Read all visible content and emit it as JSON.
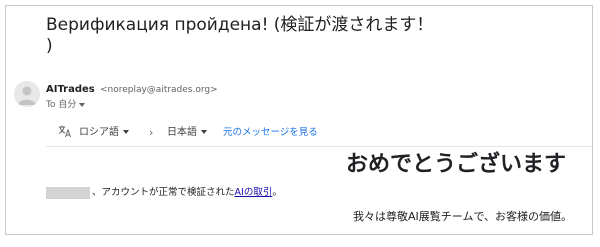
{
  "subject": "Верификация пройдена! (検証が渡されます！\n)",
  "sender": {
    "name": "AITrades",
    "email": "<noreplay@aitrades.org>",
    "to_label": "To 自分"
  },
  "translate_bar": {
    "icon": "translate-icon",
    "source_language": "ロシア語",
    "arrow": "›",
    "target_language": "日本語",
    "view_original": "元のメッセージを見る"
  },
  "email_body": {
    "headline": "おめでとうございます",
    "account_text_before": "、アカウントが正常で検証された",
    "account_link": "AIの取引",
    "account_text_after": "。",
    "team_text": "我々は尊敬AI展覧チームで、お客様の価値。"
  },
  "colors": {
    "link_blue": "#1a73e8",
    "body_link": "#1a0dab",
    "border": "#c9c9c9"
  }
}
